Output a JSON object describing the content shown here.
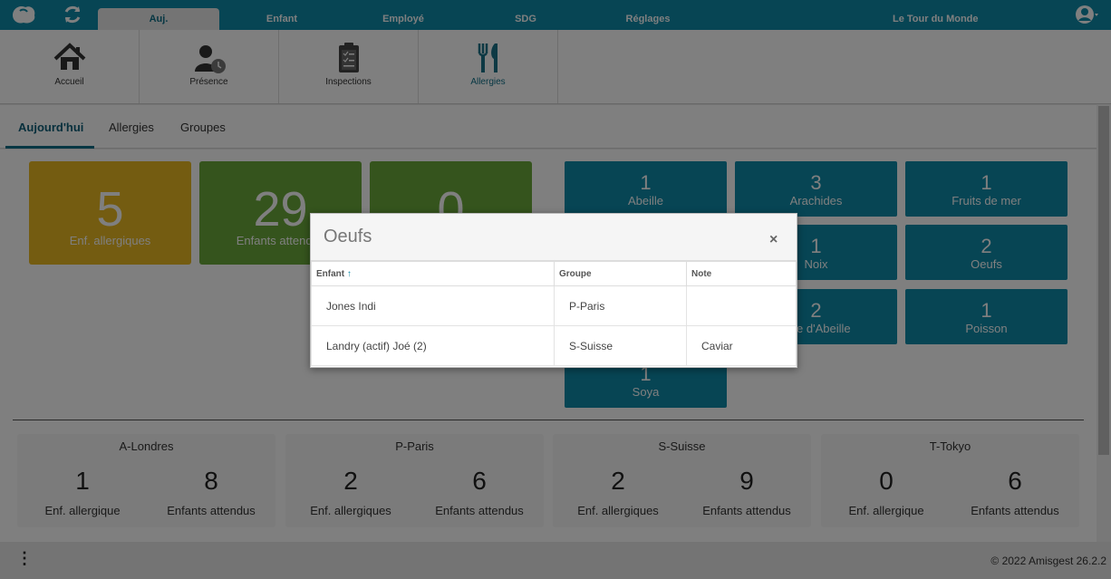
{
  "topbar": {
    "tabs": [
      "Auj.",
      "Enfant",
      "Employé",
      "SDG",
      "Réglages"
    ],
    "active_tab": "Auj.",
    "organization": "Le Tour du Monde"
  },
  "modules": [
    {
      "label": "Accueil",
      "icon": "home-icon"
    },
    {
      "label": "Présence",
      "icon": "presence-icon"
    },
    {
      "label": "Inspections",
      "icon": "clipboard-icon"
    },
    {
      "label": "Allergies",
      "icon": "utensils-icon"
    }
  ],
  "subtabs": [
    "Aujourd'hui",
    "Allergies",
    "Groupes"
  ],
  "stats": [
    {
      "value": "5",
      "label": "Enf. allergiques",
      "color": "#e8b923"
    },
    {
      "value": "29",
      "label": "Enfants attendus",
      "color": "#6aa93a"
    },
    {
      "value": "0",
      "label": "",
      "color": "#6aa93a"
    }
  ],
  "allergies": [
    {
      "count": "1",
      "name": "Abeille"
    },
    {
      "count": "3",
      "name": "Arachides"
    },
    {
      "count": "1",
      "name": "Fruits de mer"
    },
    {
      "count": "1",
      "name": "Noix"
    },
    {
      "count": "2",
      "name": "Oeufs"
    },
    {
      "count": "2",
      "name": "Cire d'Abeille"
    },
    {
      "count": "1",
      "name": "Poisson"
    },
    {
      "count": "1",
      "name": "Soya"
    }
  ],
  "groups": [
    {
      "name": "A-Londres",
      "allergic": "1",
      "allergic_label": "Enf. allergique",
      "expected": "8",
      "expected_label": "Enfants attendus"
    },
    {
      "name": "P-Paris",
      "allergic": "2",
      "allergic_label": "Enf. allergiques",
      "expected": "6",
      "expected_label": "Enfants attendus"
    },
    {
      "name": "S-Suisse",
      "allergic": "2",
      "allergic_label": "Enf. allergiques",
      "expected": "9",
      "expected_label": "Enfants attendus"
    },
    {
      "name": "T-Tokyo",
      "allergic": "0",
      "allergic_label": "Enf. allergique",
      "expected": "6",
      "expected_label": "Enfants attendus"
    }
  ],
  "modal": {
    "title": "Oeufs",
    "close": "×",
    "columns": [
      "Enfant",
      "Groupe",
      "Note"
    ],
    "sort_indicator": "↑",
    "rows": [
      {
        "enfant": "Jones Indi",
        "groupe": "P-Paris",
        "note": ""
      },
      {
        "enfant": "Landry (actif) Joé (2)",
        "groupe": "S-Suisse",
        "note": "Caviar"
      }
    ]
  },
  "footer": {
    "menu": "⋮",
    "copyright": "© 2022 Amisgest 26.2.2"
  },
  "colors": {
    "brand": "#0e8aa8",
    "yellow": "#e8b923",
    "green": "#6aa93a"
  }
}
